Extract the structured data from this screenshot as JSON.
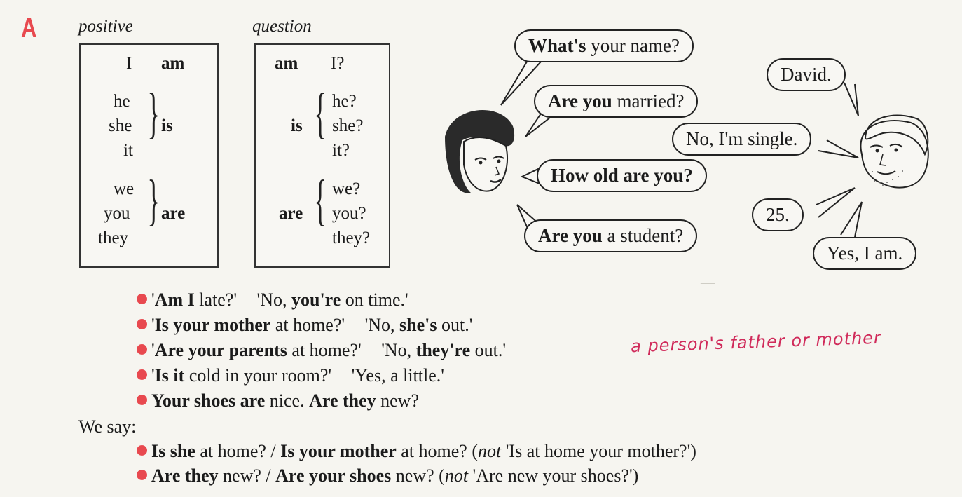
{
  "section": "A",
  "columns": {
    "positive": "positive",
    "question": "question"
  },
  "positive": {
    "i": "I",
    "am": "am",
    "he": "he",
    "she": "she",
    "it": "it",
    "is": "is",
    "we": "we",
    "you": "you",
    "they": "they",
    "are": "are"
  },
  "question": {
    "am": "am",
    "i": "I?",
    "is": "is",
    "he": "he?",
    "she": "she?",
    "it": "it?",
    "are": "are",
    "we": "we?",
    "you": "you?",
    "they": "they?"
  },
  "bubbles": {
    "b1_bold": "What's",
    "b1_rest": " your name?",
    "b2_bold": "Are you",
    "b2_rest": " married?",
    "b3_bold": "How old are you?",
    "b4_bold": "Are you",
    "b4_rest": " a student?",
    "r1": "David.",
    "r2": "No, I'm single.",
    "r3": "25.",
    "r4": "Yes, I am."
  },
  "examples": [
    {
      "q_bold": "Am I",
      "q_rest": " late?'",
      "a_pre": "'No, ",
      "a_bold": "you're",
      "a_rest": " on time.'"
    },
    {
      "q_bold": "Is your mother",
      "q_rest": " at home?'",
      "a_pre": "'No, ",
      "a_bold": "she's",
      "a_rest": " out.'"
    },
    {
      "q_bold": "Are your parents",
      "q_rest": " at home?'",
      "a_pre": "'No, ",
      "a_bold": "they're",
      "a_rest": " out.'"
    },
    {
      "q_bold": "Is it",
      "q_rest": " cold in your room?'",
      "a_pre": "'Yes, a little.'"
    },
    {
      "s_bold1": "Your shoes are",
      "s_mid": " nice. ",
      "s_bold2": "Are they",
      "s_end": " new?"
    }
  ],
  "handwritten_note": "a person's father or mother",
  "we_say": "We say:",
  "we_say_lines": [
    {
      "b1": "Is she",
      "t1": " at home? / ",
      "b2": "Is your mother",
      "t2": " at home? (",
      "it": "not",
      "t3": " 'Is at home your mother?')"
    },
    {
      "b1": "Are they",
      "t1": " new? / ",
      "b2": "Are your shoes",
      "t2": " new? (",
      "it": "not",
      "t3": " 'Are new your shoes?')"
    }
  ],
  "colors": {
    "accent": "#e8494f",
    "handwriting": "#d02a5a"
  }
}
